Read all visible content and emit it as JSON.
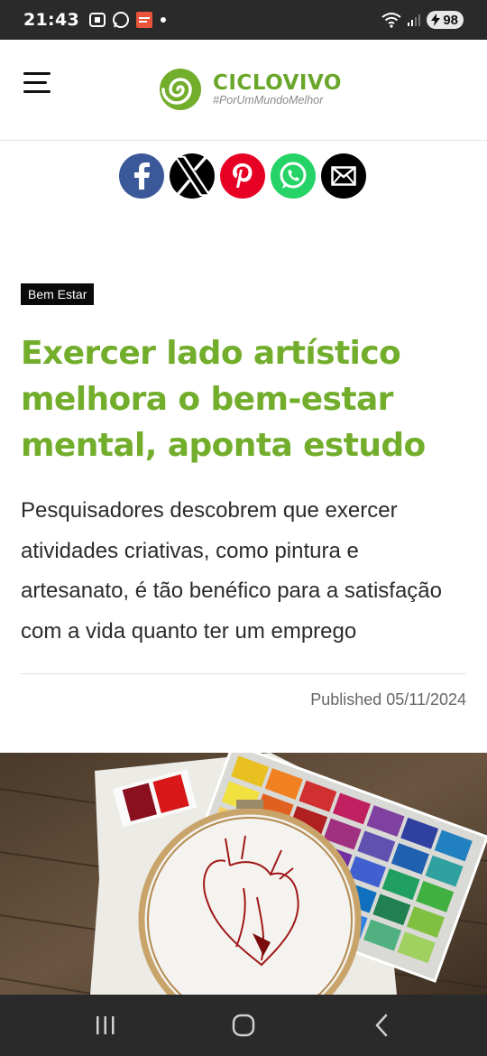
{
  "status_bar": {
    "time": "21:43",
    "battery": "98"
  },
  "header": {
    "logo_brand": "CICLOVIVO",
    "logo_tagline": "#PorUmMundoMelhor"
  },
  "share": {
    "items": [
      "facebook",
      "x",
      "pinterest",
      "whatsapp",
      "email"
    ],
    "colors": {
      "facebook": "#3b5998",
      "x": "#000000",
      "pinterest": "#e60023",
      "whatsapp": "#25d366",
      "email": "#000000"
    }
  },
  "article": {
    "category": "Bem Estar",
    "title": "Exercer lado artístico melhora o bem-estar mental, aponta estudo",
    "lead": "Pesquisadores descobrem que exercer atividades criativas, como pintura e artesanato, é tão benéfico para a satisfação com a vida quanto ter um emprego",
    "published": "Published 05/11/2024"
  },
  "colors": {
    "accent": "#72ad2b",
    "status_bar": "#2a2a2a"
  }
}
